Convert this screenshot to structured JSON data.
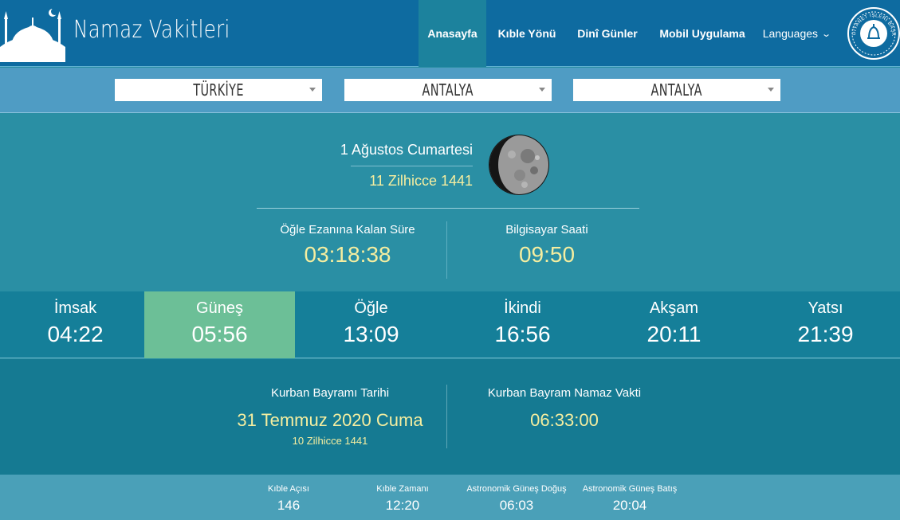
{
  "header": {
    "brand": "Namaz Vakitleri",
    "nav": {
      "home": "Anasayfa",
      "kible": "Kıble Yönü",
      "dini": "Dinî Günler",
      "mobil": "Mobil Uygulama",
      "languages": "Languages"
    },
    "seal_text": "DİYANET İŞLERİ BAŞKANLIĞI",
    "active_color": "#1c829d"
  },
  "selectors": {
    "country": "TÜRKİYE",
    "province": "ANTALYA",
    "district": "ANTALYA"
  },
  "date": {
    "gregorian": "1 Ağustos Cumartesi",
    "hijri": "11 Zilhicce 1441"
  },
  "countdown": {
    "label": "Öğle Ezanına Kalan Süre",
    "value": "03:18:38"
  },
  "clock": {
    "label": "Bilgisayar Saati",
    "value": "09:50"
  },
  "times": [
    {
      "name": "İmsak",
      "time": "04:22"
    },
    {
      "name": "Güneş",
      "time": "05:56"
    },
    {
      "name": "Öğle",
      "time": "13:09"
    },
    {
      "name": "İkindi",
      "time": "16:56"
    },
    {
      "name": "Akşam",
      "time": "20:11"
    },
    {
      "name": "Yatsı",
      "time": "21:39"
    }
  ],
  "active_time_index": 1,
  "bayram": {
    "date_label": "Kurban Bayramı Tarihi",
    "date_value": "31 Temmuz 2020 Cuma",
    "date_hijri": "10 Zilhicce 1441",
    "prayer_label": "Kurban Bayram Namaz Vakti",
    "prayer_value": "06:33:00"
  },
  "info": [
    {
      "label": "Kıble Açısı",
      "value": "146"
    },
    {
      "label": "Kıble Zamanı",
      "value": "12:20"
    },
    {
      "label": "Astronomik Güneş Doğuş",
      "value": "06:03"
    },
    {
      "label": "Astronomik Güneş Batış",
      "value": "20:04"
    }
  ],
  "colors": {
    "header": "#0e6ba0",
    "accent_yellow": "#f5eea0",
    "active_cell": "#6cbf97"
  }
}
